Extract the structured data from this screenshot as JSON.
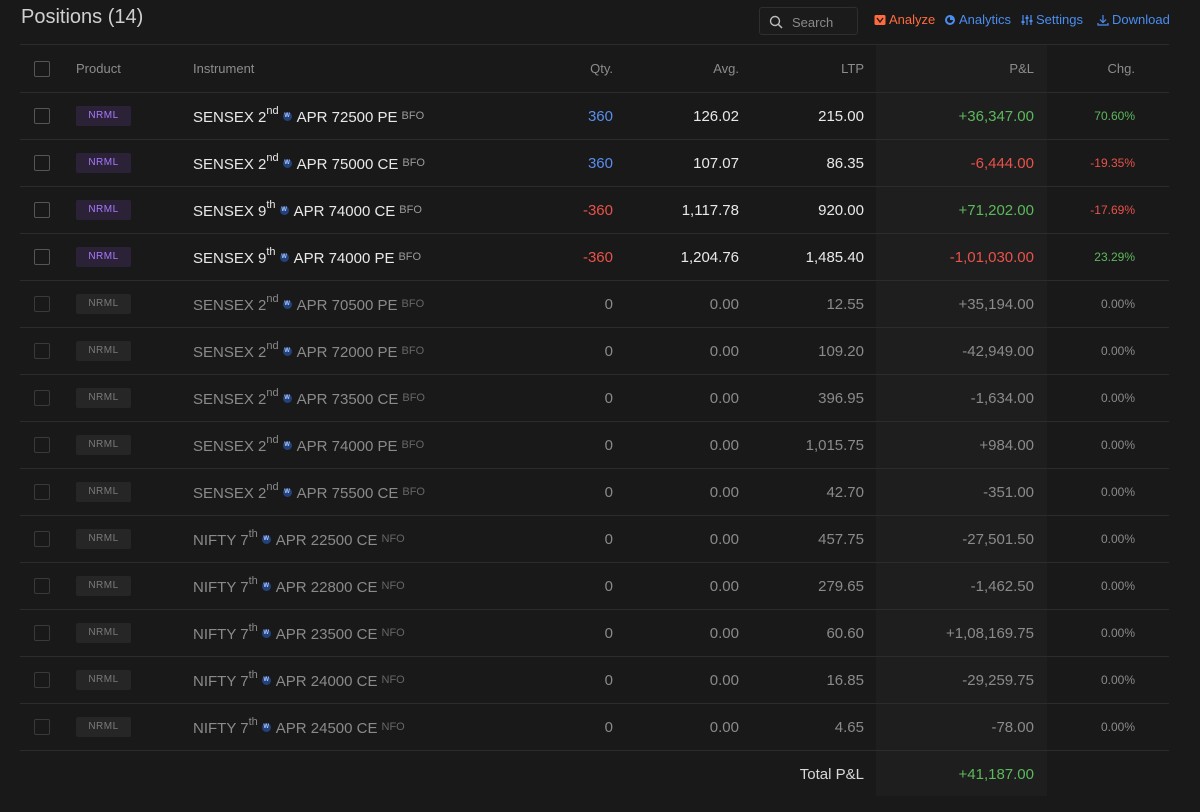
{
  "header": {
    "title": "Positions (14)",
    "search_placeholder": "Search",
    "analyze_label": "Analyze",
    "analytics_label": "Analytics",
    "settings_label": "Settings",
    "download_label": "Download"
  },
  "columns": {
    "product": "Product",
    "instrument": "Instrument",
    "qty": "Qty.",
    "avg": "Avg.",
    "ltp": "LTP",
    "pnl": "P&L",
    "chg": "Chg."
  },
  "colors": {
    "positive": "#5cb85c",
    "negative": "#e8524a",
    "accent_blue": "#4a8df0",
    "analyze_orange": "#ff6b3d",
    "product_badge": "#a878ff"
  },
  "positions": [
    {
      "product": "NRML",
      "symbol": "SENSEX",
      "day": "2",
      "suffix": "nd",
      "month_strike": "APR 72500 PE",
      "exchange": "BFO",
      "qty": "360",
      "qty_sign": "pos",
      "avg": "126.02",
      "ltp": "215.00",
      "pnl": "+36,347.00",
      "pnl_sign": "pos",
      "chg": "70.60%",
      "chg_sign": "pos",
      "open": true
    },
    {
      "product": "NRML",
      "symbol": "SENSEX",
      "day": "2",
      "suffix": "nd",
      "month_strike": "APR 75000 CE",
      "exchange": "BFO",
      "qty": "360",
      "qty_sign": "pos",
      "avg": "107.07",
      "ltp": "86.35",
      "pnl": "-6,444.00",
      "pnl_sign": "neg",
      "chg": "-19.35%",
      "chg_sign": "neg",
      "open": true
    },
    {
      "product": "NRML",
      "symbol": "SENSEX",
      "day": "9",
      "suffix": "th",
      "month_strike": "APR 74000 CE",
      "exchange": "BFO",
      "qty": "-360",
      "qty_sign": "neg",
      "avg": "1,117.78",
      "ltp": "920.00",
      "pnl": "+71,202.00",
      "pnl_sign": "pos",
      "chg": "-17.69%",
      "chg_sign": "neg",
      "open": true
    },
    {
      "product": "NRML",
      "symbol": "SENSEX",
      "day": "9",
      "suffix": "th",
      "month_strike": "APR 74000 PE",
      "exchange": "BFO",
      "qty": "-360",
      "qty_sign": "neg",
      "avg": "1,204.76",
      "ltp": "1,485.40",
      "pnl": "-1,01,030.00",
      "pnl_sign": "neg",
      "chg": "23.29%",
      "chg_sign": "pos",
      "open": true
    },
    {
      "product": "NRML",
      "symbol": "SENSEX",
      "day": "2",
      "suffix": "nd",
      "month_strike": "APR 70500 PE",
      "exchange": "BFO",
      "qty": "0",
      "qty_sign": "zero",
      "avg": "0.00",
      "ltp": "12.55",
      "pnl": "+35,194.00",
      "pnl_sign": "zero",
      "chg": "0.00%",
      "chg_sign": "zero",
      "open": false
    },
    {
      "product": "NRML",
      "symbol": "SENSEX",
      "day": "2",
      "suffix": "nd",
      "month_strike": "APR 72000 PE",
      "exchange": "BFO",
      "qty": "0",
      "qty_sign": "zero",
      "avg": "0.00",
      "ltp": "109.20",
      "pnl": "-42,949.00",
      "pnl_sign": "zero",
      "chg": "0.00%",
      "chg_sign": "zero",
      "open": false
    },
    {
      "product": "NRML",
      "symbol": "SENSEX",
      "day": "2",
      "suffix": "nd",
      "month_strike": "APR 73500 CE",
      "exchange": "BFO",
      "qty": "0",
      "qty_sign": "zero",
      "avg": "0.00",
      "ltp": "396.95",
      "pnl": "-1,634.00",
      "pnl_sign": "zero",
      "chg": "0.00%",
      "chg_sign": "zero",
      "open": false
    },
    {
      "product": "NRML",
      "symbol": "SENSEX",
      "day": "2",
      "suffix": "nd",
      "month_strike": "APR 74000 PE",
      "exchange": "BFO",
      "qty": "0",
      "qty_sign": "zero",
      "avg": "0.00",
      "ltp": "1,015.75",
      "pnl": "+984.00",
      "pnl_sign": "zero",
      "chg": "0.00%",
      "chg_sign": "zero",
      "open": false
    },
    {
      "product": "NRML",
      "symbol": "SENSEX",
      "day": "2",
      "suffix": "nd",
      "month_strike": "APR 75500 CE",
      "exchange": "BFO",
      "qty": "0",
      "qty_sign": "zero",
      "avg": "0.00",
      "ltp": "42.70",
      "pnl": "-351.00",
      "pnl_sign": "zero",
      "chg": "0.00%",
      "chg_sign": "zero",
      "open": false
    },
    {
      "product": "NRML",
      "symbol": "NIFTY",
      "day": "7",
      "suffix": "th",
      "month_strike": "APR 22500 CE",
      "exchange": "NFO",
      "qty": "0",
      "qty_sign": "zero",
      "avg": "0.00",
      "ltp": "457.75",
      "pnl": "-27,501.50",
      "pnl_sign": "zero",
      "chg": "0.00%",
      "chg_sign": "zero",
      "open": false
    },
    {
      "product": "NRML",
      "symbol": "NIFTY",
      "day": "7",
      "suffix": "th",
      "month_strike": "APR 22800 CE",
      "exchange": "NFO",
      "qty": "0",
      "qty_sign": "zero",
      "avg": "0.00",
      "ltp": "279.65",
      "pnl": "-1,462.50",
      "pnl_sign": "zero",
      "chg": "0.00%",
      "chg_sign": "zero",
      "open": false
    },
    {
      "product": "NRML",
      "symbol": "NIFTY",
      "day": "7",
      "suffix": "th",
      "month_strike": "APR 23500 CE",
      "exchange": "NFO",
      "qty": "0",
      "qty_sign": "zero",
      "avg": "0.00",
      "ltp": "60.60",
      "pnl": "+1,08,169.75",
      "pnl_sign": "zero",
      "chg": "0.00%",
      "chg_sign": "zero",
      "open": false
    },
    {
      "product": "NRML",
      "symbol": "NIFTY",
      "day": "7",
      "suffix": "th",
      "month_strike": "APR 24000 CE",
      "exchange": "NFO",
      "qty": "0",
      "qty_sign": "zero",
      "avg": "0.00",
      "ltp": "16.85",
      "pnl": "-29,259.75",
      "pnl_sign": "zero",
      "chg": "0.00%",
      "chg_sign": "zero",
      "open": false
    },
    {
      "product": "NRML",
      "symbol": "NIFTY",
      "day": "7",
      "suffix": "th",
      "month_strike": "APR 24500 CE",
      "exchange": "NFO",
      "qty": "0",
      "qty_sign": "zero",
      "avg": "0.00",
      "ltp": "4.65",
      "pnl": "-78.00",
      "pnl_sign": "zero",
      "chg": "0.00%",
      "chg_sign": "zero",
      "open": false
    }
  ],
  "weekly_badge": "W",
  "total": {
    "label": "Total P&L",
    "value": "+41,187.00"
  }
}
